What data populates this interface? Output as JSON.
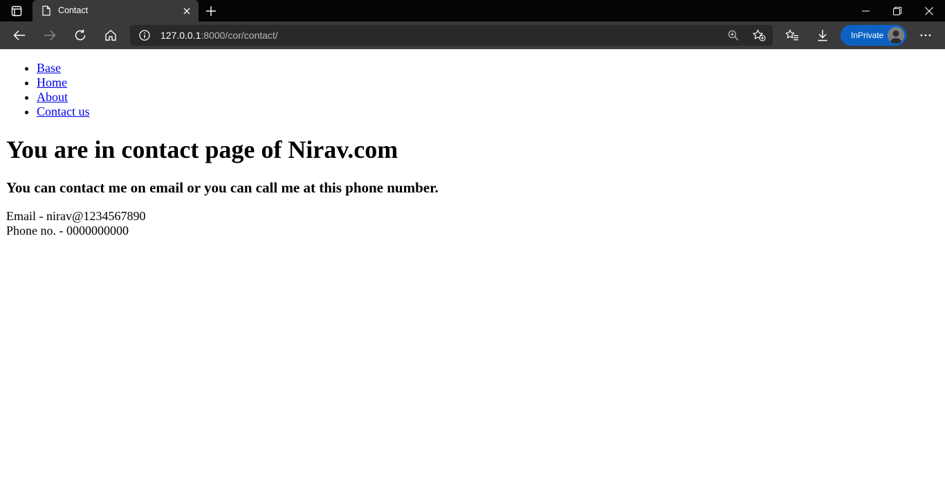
{
  "browser": {
    "tab": {
      "title": "Contact"
    },
    "address": {
      "host": "127.0.0.1",
      "path": ":8000/cor/contact/"
    },
    "inprivate_label": "InPrivate",
    "icons": {
      "tab_actions": "tab-actions-icon",
      "favicon": "page-icon",
      "tab_close": "close-icon",
      "new_tab": "plus-icon",
      "back": "arrow-left-icon",
      "forward": "arrow-right-icon",
      "reload": "reload-icon",
      "home": "home-icon",
      "site_info": "info-icon",
      "zoom": "zoom-icon",
      "add_favorite": "star-add-icon",
      "favorites": "favorites-icon",
      "downloads": "download-icon",
      "more": "more-icon"
    },
    "colors": {
      "accent": "#0b62c4",
      "titlebar": "#050508",
      "toolbar": "#3a3a3d"
    }
  },
  "page": {
    "nav": [
      {
        "label": "Base"
      },
      {
        "label": "Home"
      },
      {
        "label": "About"
      },
      {
        "label": "Contact us"
      }
    ],
    "heading": "You are in contact page of Nirav.com",
    "subheading": "You can contact me on email or you can call me at this phone number.",
    "email_line": "Email - nirav@1234567890",
    "phone_line": "Phone no. - 0000000000"
  }
}
